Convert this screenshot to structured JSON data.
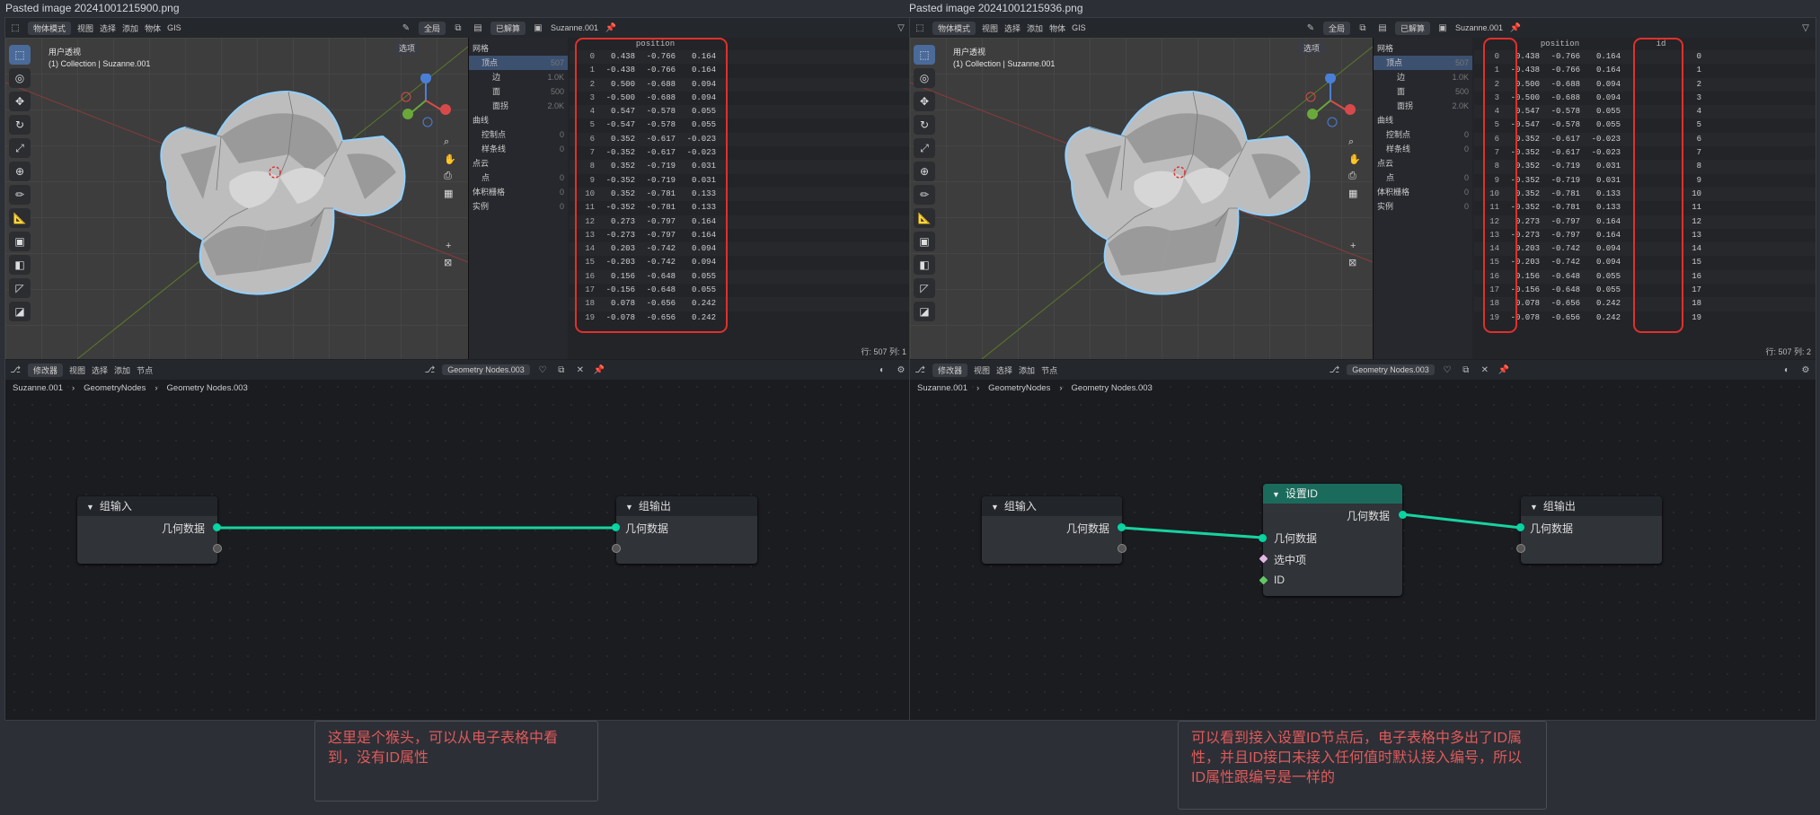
{
  "captions": {
    "left": "Pasted image 20241001215900.png",
    "right": "Pasted image 20241001215936.png"
  },
  "header": {
    "mode": "物体模式",
    "menus": [
      "视图",
      "选择",
      "添加",
      "物体",
      "GIS"
    ],
    "global": "全局",
    "options": "选项",
    "evaluated": "已解算",
    "object": "Suzanne.001"
  },
  "viewport": {
    "view_name": "用户透视",
    "collection": "(1) Collection | Suzanne.001"
  },
  "tree": [
    {
      "label": "网格",
      "count": ""
    },
    {
      "label": "顶点",
      "count": "507"
    },
    {
      "label": "边",
      "count": "1.0K"
    },
    {
      "label": "面",
      "count": "500"
    },
    {
      "label": "面拐",
      "count": "2.0K"
    },
    {
      "label": "曲线",
      "count": ""
    },
    {
      "label": "控制点",
      "count": "0"
    },
    {
      "label": "样条线",
      "count": "0"
    },
    {
      "label": "点云",
      "count": ""
    },
    {
      "label": "点",
      "count": "0"
    },
    {
      "label": "体积栅格",
      "count": "0"
    },
    {
      "label": "实例",
      "count": "0"
    }
  ],
  "spreadsheet": {
    "col_position": "position",
    "col_id": "id",
    "rows": [
      [
        "0",
        "0.438",
        "-0.766",
        "0.164",
        "0"
      ],
      [
        "1",
        "-0.438",
        "-0.766",
        "0.164",
        "1"
      ],
      [
        "2",
        "0.500",
        "-0.688",
        "0.094",
        "2"
      ],
      [
        "3",
        "-0.500",
        "-0.688",
        "0.094",
        "3"
      ],
      [
        "4",
        "0.547",
        "-0.578",
        "0.055",
        "4"
      ],
      [
        "5",
        "-0.547",
        "-0.578",
        "0.055",
        "5"
      ],
      [
        "6",
        "0.352",
        "-0.617",
        "-0.023",
        "6"
      ],
      [
        "7",
        "-0.352",
        "-0.617",
        "-0.023",
        "7"
      ],
      [
        "8",
        "0.352",
        "-0.719",
        "0.031",
        "8"
      ],
      [
        "9",
        "-0.352",
        "-0.719",
        "0.031",
        "9"
      ],
      [
        "10",
        "0.352",
        "-0.781",
        "0.133",
        "10"
      ],
      [
        "11",
        "-0.352",
        "-0.781",
        "0.133",
        "11"
      ],
      [
        "12",
        "0.273",
        "-0.797",
        "0.164",
        "12"
      ],
      [
        "13",
        "-0.273",
        "-0.797",
        "0.164",
        "13"
      ],
      [
        "14",
        "0.203",
        "-0.742",
        "0.094",
        "14"
      ],
      [
        "15",
        "-0.203",
        "-0.742",
        "0.094",
        "15"
      ],
      [
        "16",
        "0.156",
        "-0.648",
        "0.055",
        "16"
      ],
      [
        "17",
        "-0.156",
        "-0.648",
        "0.055",
        "17"
      ],
      [
        "18",
        "0.078",
        "-0.656",
        "0.242",
        "18"
      ],
      [
        "19",
        "-0.078",
        "-0.656",
        "0.242",
        "19"
      ]
    ],
    "footer_left": "行: 507   列: 1",
    "footer_right": "行: 507   列: 2"
  },
  "node_header": {
    "editor": "修改器",
    "menus": [
      "视图",
      "选择",
      "添加",
      "节点"
    ],
    "tree_name": "Geometry Nodes.003"
  },
  "breadcrumb": [
    "Suzanne.001",
    "GeometryNodes",
    "Geometry Nodes.003"
  ],
  "nodes": {
    "group_input": "组输入",
    "group_output": "组输出",
    "geometry": "几何数据",
    "set_id": "设置ID",
    "selection": "选中项",
    "id": "ID"
  },
  "notes": {
    "left": "这里是个猴头，可以从电子表格中看到，没有ID属性",
    "right": "可以看到接入设置ID节点后，电子表格中多出了ID属性，并且ID接口未接入任何值时默认接入编号，所以ID属性跟编号是一样的"
  }
}
